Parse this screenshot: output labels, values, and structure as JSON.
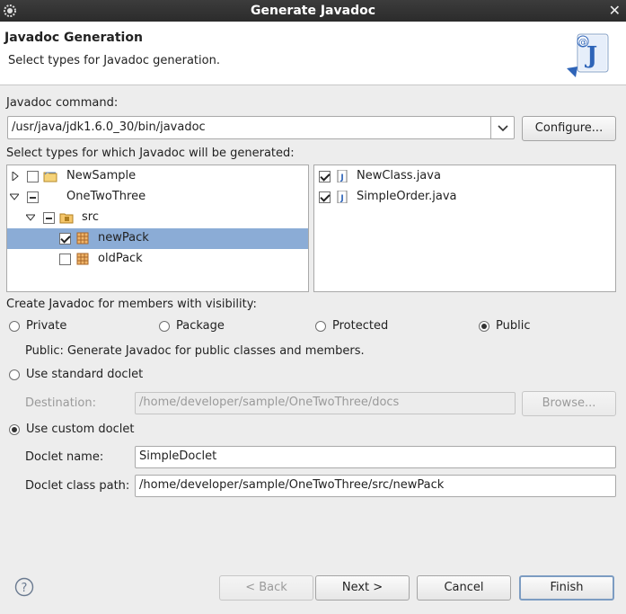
{
  "window": {
    "title": "Generate Javadoc"
  },
  "header": {
    "title": "Javadoc Generation",
    "subtitle": "Select types for Javadoc generation."
  },
  "javadoc_command": {
    "label": "Javadoc command:",
    "value": "/usr/java/jdk1.6.0_30/bin/javadoc",
    "configure_label": "Configure..."
  },
  "types_label": "Select types for which Javadoc will be generated:",
  "tree": [
    {
      "label": "NewSample",
      "state": "unchecked",
      "expanded": false,
      "icon": "project-icon",
      "level": 0
    },
    {
      "label": "OneTwoThree",
      "state": "mixed",
      "expanded": true,
      "icon": "none",
      "level": 0
    },
    {
      "label": "src",
      "state": "mixed",
      "expanded": true,
      "icon": "source-folder-icon",
      "level": 1
    },
    {
      "label": "newPack",
      "state": "checked",
      "icon": "package-icon",
      "level": 2,
      "selected": true
    },
    {
      "label": "oldPack",
      "state": "unchecked",
      "icon": "package-icon",
      "level": 2
    }
  ],
  "files": [
    {
      "label": "NewClass.java",
      "checked": true,
      "icon": "java-file-icon"
    },
    {
      "label": "SimpleOrder.java",
      "checked": true,
      "icon": "java-file-icon"
    }
  ],
  "visibility": {
    "label": "Create Javadoc for members with visibility:",
    "options": [
      "Private",
      "Package",
      "Protected",
      "Public"
    ],
    "selected": "Public",
    "description": "Public: Generate Javadoc for public classes and members."
  },
  "standard_doclet": {
    "label": "Use standard doclet",
    "selected": false,
    "destination_label": "Destination:",
    "destination_value": "/home/developer/sample/OneTwoThree/docs",
    "browse_label": "Browse..."
  },
  "custom_doclet": {
    "label": "Use custom doclet",
    "selected": true,
    "name_label": "Doclet name:",
    "name_value": "SimpleDoclet",
    "path_label": "Doclet class path:",
    "path_value": "/home/developer/sample/OneTwoThree/src/newPack"
  },
  "buttons": {
    "back": "< Back",
    "next": "Next >",
    "cancel": "Cancel",
    "finish": "Finish"
  },
  "colors": {
    "selection": "#8bacd6",
    "titlebar": "#2b2b2b"
  }
}
